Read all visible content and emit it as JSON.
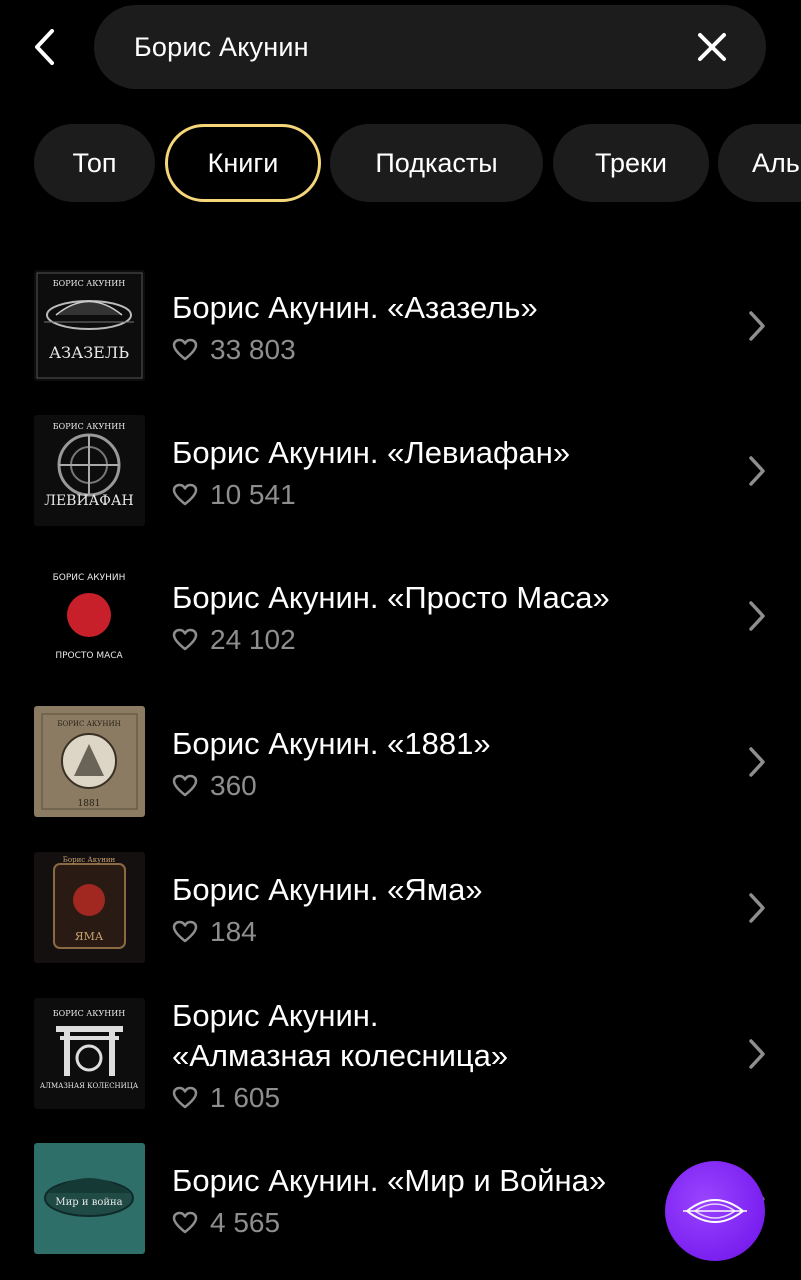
{
  "search": {
    "value": "Борис Акунин"
  },
  "tabs": [
    {
      "label": "Топ",
      "active": false
    },
    {
      "label": "Книги",
      "active": true
    },
    {
      "label": "Подкасты",
      "active": false
    },
    {
      "label": "Треки",
      "active": false
    },
    {
      "label": "Аль",
      "active": false
    }
  ],
  "books": [
    {
      "title_line1": "Борис Акунин. «Азазель»",
      "title_line2": "",
      "likes": "33 803",
      "cover": {
        "author": "БОРИС АКУНИН",
        "name": "АЗАЗЕЛЬ",
        "bg": "#0d0d0d",
        "fg": "#e8e8e8"
      }
    },
    {
      "title_line1": "Борис Акунин. «Левиафан»",
      "title_line2": "",
      "likes": "10 541",
      "cover": {
        "author": "БОРИС АКУНИН",
        "name": "ЛЕВИАФАН",
        "bg": "#0d0d0d",
        "fg": "#e8e8e8"
      }
    },
    {
      "title_line1": "Борис Акунин. «Просто Маса»",
      "title_line2": "",
      "likes": "24 102",
      "cover": {
        "author": "БОРИС АКУНИН",
        "name": "ПРОСТО МАСА",
        "bg": "#000000",
        "fg": "#e8e8e8",
        "accent": "#c8202a"
      }
    },
    {
      "title_line1": "Борис Акунин. «1881»",
      "title_line2": "",
      "likes": "360",
      "cover": {
        "author": "БОРИС АКУНИН",
        "name": "1881",
        "bg": "#8a7b62",
        "fg": "#2a2218"
      }
    },
    {
      "title_line1": "Борис Акунин. «Яма»",
      "title_line2": "",
      "likes": "184",
      "cover": {
        "author": "Борис Акунин",
        "name": "ЯМА",
        "bg": "#141010",
        "fg": "#c8a070",
        "accent": "#a02820"
      }
    },
    {
      "title_line1": "Борис Акунин.",
      "title_line2": "«Алмазная колесница»",
      "likes": "1 605",
      "cover": {
        "author": "БОРИС АКУНИН",
        "name": "АЛМАЗНАЯ КОЛЕСНИЦА",
        "bg": "#0d0d0d",
        "fg": "#e8e8e8"
      }
    },
    {
      "title_line1": "Борис Акунин. «Мир и Война»",
      "title_line2": "",
      "likes": "4 565",
      "cover": {
        "author": "",
        "name": "Мир и война",
        "bg": "#2f6f6a",
        "fg": "#e8e8e8"
      }
    }
  ],
  "colors": {
    "accent_border": "#f5d77a",
    "fab": "#8a33f5",
    "muted": "#8e8e8e"
  }
}
